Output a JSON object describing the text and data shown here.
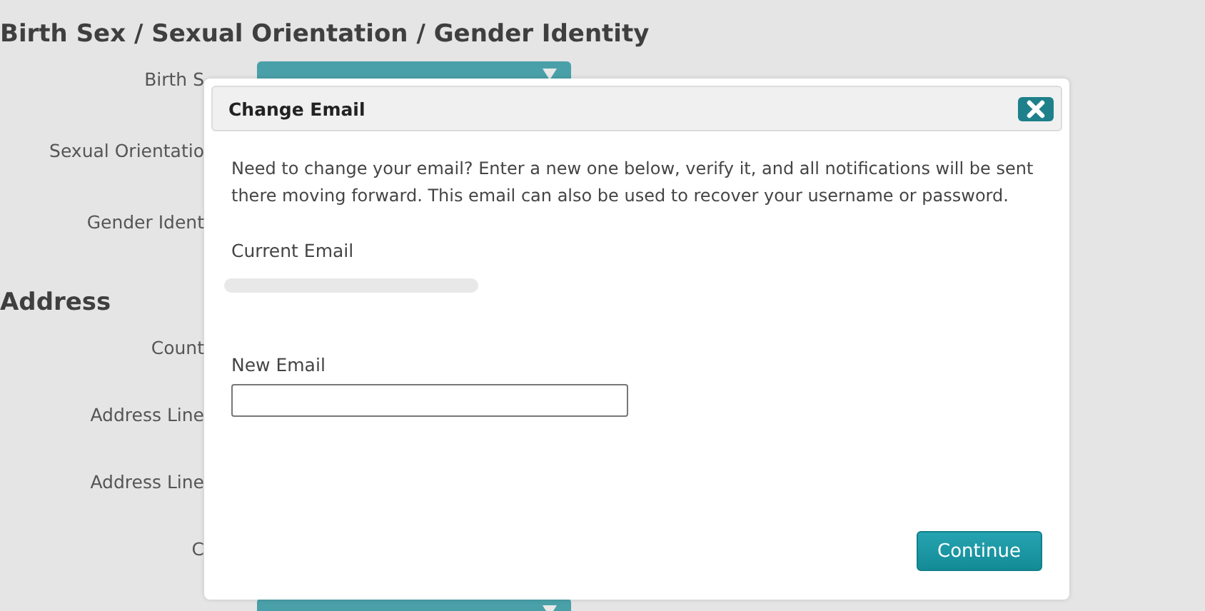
{
  "background_form": {
    "sections": [
      {
        "heading": "Birth Sex / Sexual Orientation / Gender Identity",
        "fields": [
          {
            "label": "Birth S",
            "kind": "dropdown"
          },
          {
            "label": "Sexual Orientatio",
            "kind": "hidden"
          },
          {
            "label": "Gender Ident",
            "kind": "hidden"
          }
        ]
      },
      {
        "heading": "Address",
        "fields": [
          {
            "label": "Count",
            "kind": "hidden"
          },
          {
            "label": "Address Line",
            "kind": "hidden"
          },
          {
            "label": "Address Line",
            "kind": "hidden"
          },
          {
            "label": "C",
            "kind": "hidden"
          },
          {
            "kind": "dropdown"
          }
        ]
      }
    ]
  },
  "dialog": {
    "title": "Change Email",
    "intro": "Need to change your email? Enter a new one below, verify it, and all notifications will be sent there moving forward. This email can also be used to recover your username or password.",
    "current_email_label": "Current Email",
    "new_email_label": "New Email",
    "button": "Continue"
  }
}
